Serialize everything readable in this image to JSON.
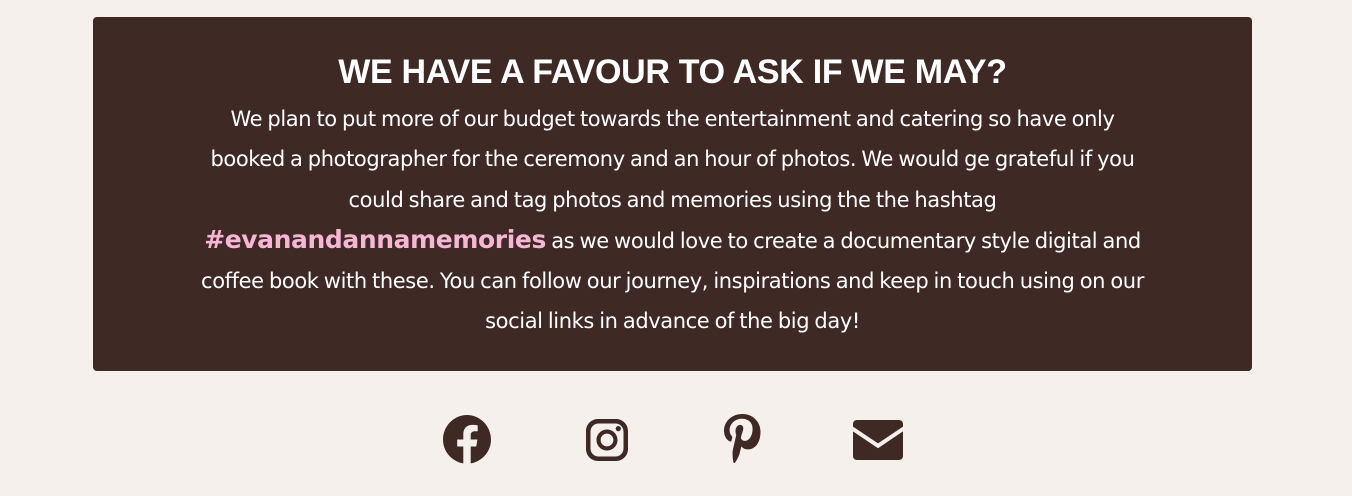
{
  "favour": {
    "title": "WE HAVE A FAVOUR TO ASK IF WE MAY?",
    "line1": "We plan to put more of our budget towards the entertainment and catering so have only",
    "line2": "booked a photographer for the ceremony and an hour of photos. We would ge grateful if you",
    "line3": "could share and tag photos and memories using the the hashtag",
    "hashtag": "#evanandannamemories",
    "line4_after_hashtag": " as we would love to create a documentary style digital and",
    "line5": "coffee book with these. You can follow our journey, inspirations and keep in touch using on our",
    "line6": "social links in advance of the big day!"
  },
  "colors": {
    "background": "#f5f0ec",
    "card": "#3e2924",
    "text": "#ffffff",
    "hashtag": "#f7b6d6",
    "icons": "#3e2924"
  },
  "social": {
    "icons": [
      "facebook-icon",
      "instagram-icon",
      "pinterest-icon",
      "email-icon"
    ]
  }
}
